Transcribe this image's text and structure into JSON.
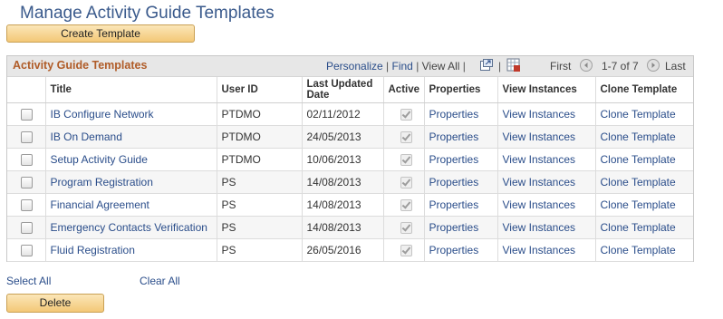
{
  "page_title": "Manage Activity Guide Templates",
  "create_button": "Create Template",
  "grid": {
    "title": "Activity Guide Templates",
    "personalize": "Personalize",
    "find": "Find",
    "view_all": "View All",
    "first": "First",
    "range": "1-7 of 7",
    "last": "Last",
    "columns": {
      "title": "Title",
      "user_id": "User ID",
      "last_updated": "Last Updated Date",
      "active": "Active",
      "properties": "Properties",
      "view_instances": "View Instances",
      "clone_template": "Clone Template"
    },
    "rows": [
      {
        "title": "IB Configure Network",
        "user": "PTDMO",
        "date": "02/11/2012",
        "properties": "Properties",
        "view": "View Instances",
        "clone": "Clone Template"
      },
      {
        "title": "IB On Demand",
        "user": "PTDMO",
        "date": "24/05/2013",
        "properties": "Properties",
        "view": "View Instances",
        "clone": "Clone Template"
      },
      {
        "title": "Setup Activity Guide",
        "user": "PTDMO",
        "date": "10/06/2013",
        "properties": "Properties",
        "view": "View Instances",
        "clone": "Clone Template"
      },
      {
        "title": "Program Registration",
        "user": "PS",
        "date": "14/08/2013",
        "properties": "Properties",
        "view": "View Instances",
        "clone": "Clone Template"
      },
      {
        "title": "Financial Agreement",
        "user": "PS",
        "date": "14/08/2013",
        "properties": "Properties",
        "view": "View Instances",
        "clone": "Clone Template"
      },
      {
        "title": "Emergency Contacts Verification",
        "user": "PS",
        "date": "14/08/2013",
        "properties": "Properties",
        "view": "View Instances",
        "clone": "Clone Template"
      },
      {
        "title": "Fluid Registration",
        "user": "PS",
        "date": "26/05/2016",
        "properties": "Properties",
        "view": "View Instances",
        "clone": "Clone Template"
      }
    ]
  },
  "select_all": "Select All",
  "clear_all": "Clear All",
  "delete_button": "Delete"
}
